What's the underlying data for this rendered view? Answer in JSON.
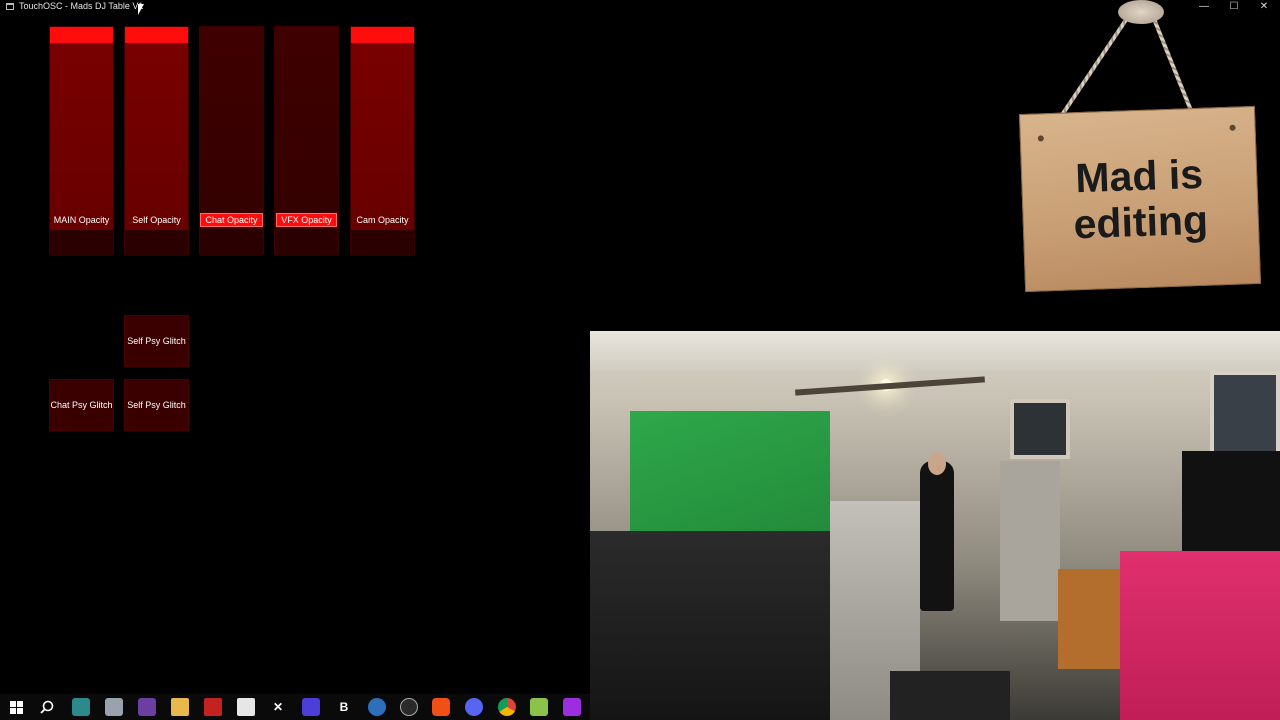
{
  "window": {
    "title": "TouchOSC - Mads DJ Table V1",
    "controls": [
      "—",
      "☐",
      "✕"
    ]
  },
  "faders": [
    {
      "label": "MAIN Opacity",
      "value": 1.0,
      "highlight": false,
      "active": true
    },
    {
      "label": "Self Opacity",
      "value": 1.0,
      "highlight": false,
      "active": true
    },
    {
      "label": "Chat Opacity",
      "value": 0.0,
      "highlight": true,
      "active": false
    },
    {
      "label": "VFX Opacity",
      "value": 0.0,
      "highlight": true,
      "active": false
    },
    {
      "label": "Cam Opacity",
      "value": 1.0,
      "highlight": false,
      "active": true
    }
  ],
  "buttons": {
    "self_psy_glitch_top": "Self  Psy Glitch",
    "chat_psy_glitch": "Chat Psy Glitch",
    "self_psy_glitch_bottom": "Self  Psy Glitch"
  },
  "sign": {
    "line1": "Mad is",
    "line2": "editing"
  },
  "colors": {
    "accent": "#ff0d0d",
    "fader_fill": "#7a0000",
    "button_bg": "#3a0000"
  },
  "taskbar": {
    "icons": [
      "windows-start-icon",
      "search-icon",
      "app-icon",
      "app-icon",
      "app-icon",
      "folder-icon",
      "app-icon",
      "app-icon",
      "capcut-icon",
      "grid-icon",
      "bold-b-icon",
      "app-icon",
      "app-icon",
      "brave-icon",
      "discord-icon",
      "chrome-icon",
      "app-icon",
      "app-icon"
    ],
    "b_label": "B"
  }
}
